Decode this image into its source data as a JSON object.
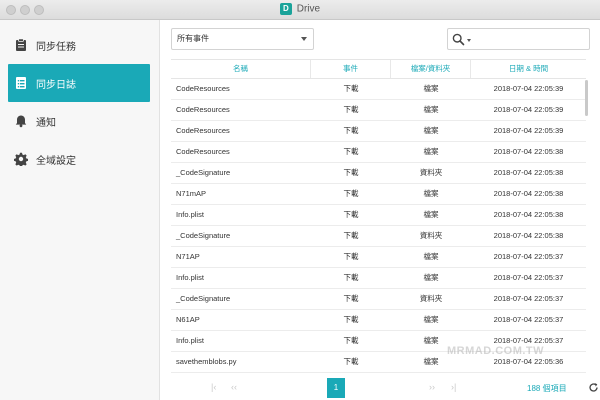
{
  "window": {
    "title": "Drive",
    "logo_letter": "D"
  },
  "sidebar": {
    "items": [
      {
        "label": "同步任務",
        "icon": "clipboard-icon"
      },
      {
        "label": "同步日誌",
        "icon": "document-list-icon",
        "active": true
      },
      {
        "label": "通知",
        "icon": "bell-icon"
      },
      {
        "label": "全域設定",
        "icon": "gear-icon"
      }
    ]
  },
  "toolbar": {
    "filter_value": "所有事件",
    "search_icon": "search-icon"
  },
  "table": {
    "columns": [
      "名稱",
      "事件",
      "檔案/資料夾",
      "日期 & 時間"
    ],
    "rows": [
      [
        "CodeResources",
        "下載",
        "檔案",
        "2018-07-04 22:05:39"
      ],
      [
        "CodeResources",
        "下載",
        "檔案",
        "2018-07-04 22:05:39"
      ],
      [
        "CodeResources",
        "下載",
        "檔案",
        "2018-07-04 22:05:39"
      ],
      [
        "CodeResources",
        "下載",
        "檔案",
        "2018-07-04 22:05:38"
      ],
      [
        "_CodeSignature",
        "下載",
        "資料夾",
        "2018-07-04 22:05:38"
      ],
      [
        "N71mAP",
        "下載",
        "檔案",
        "2018-07-04 22:05:38"
      ],
      [
        "Info.plist",
        "下載",
        "檔案",
        "2018-07-04 22:05:38"
      ],
      [
        "_CodeSignature",
        "下載",
        "資料夾",
        "2018-07-04 22:05:38"
      ],
      [
        "N71AP",
        "下載",
        "檔案",
        "2018-07-04 22:05:37"
      ],
      [
        "Info.plist",
        "下載",
        "檔案",
        "2018-07-04 22:05:37"
      ],
      [
        "_CodeSignature",
        "下載",
        "資料夾",
        "2018-07-04 22:05:37"
      ],
      [
        "N61AP",
        "下載",
        "檔案",
        "2018-07-04 22:05:37"
      ],
      [
        "Info.plist",
        "下載",
        "檔案",
        "2018-07-04 22:05:37"
      ],
      [
        "savethemblobs.py",
        "下載",
        "檔案",
        "2018-07-04 22:05:36"
      ]
    ]
  },
  "pagination": {
    "first": "|‹",
    "prev": "‹‹",
    "current": "1",
    "next": "››",
    "last": "›|",
    "total_label": "188 個項目"
  },
  "watermark": "MRMAD.COM.TW"
}
